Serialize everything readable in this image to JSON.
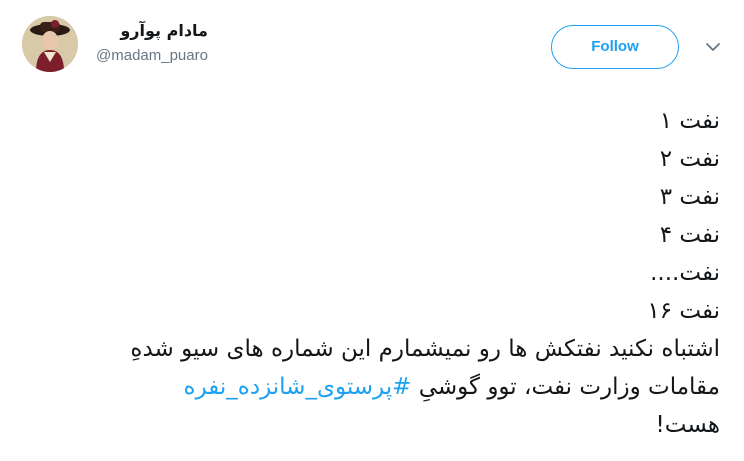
{
  "user": {
    "display_name": "مادام پوآرو",
    "username": "@madam_puaro",
    "avatar_icon": "profile-photo"
  },
  "follow_button": {
    "label": "Follow"
  },
  "caret_icon": "chevron-down-icon",
  "tweet": {
    "lines": [
      "نفت ۱",
      "نفت ۲",
      "نفت ۳",
      "نفت ۴",
      "نفت....",
      "نفت ۱۶",
      "اشتباه نکنید نفتکش ها رو نمیشمارم این شماره های سیو شدهِ",
      "مقامات وزارت نفت، توو گوشیِ ",
      "هست!"
    ],
    "hashtag": "#پرستوی_شانزده_نفره"
  },
  "colors": {
    "accent": "#1da1f2",
    "text": "#14171a",
    "secondary": "#657786"
  }
}
